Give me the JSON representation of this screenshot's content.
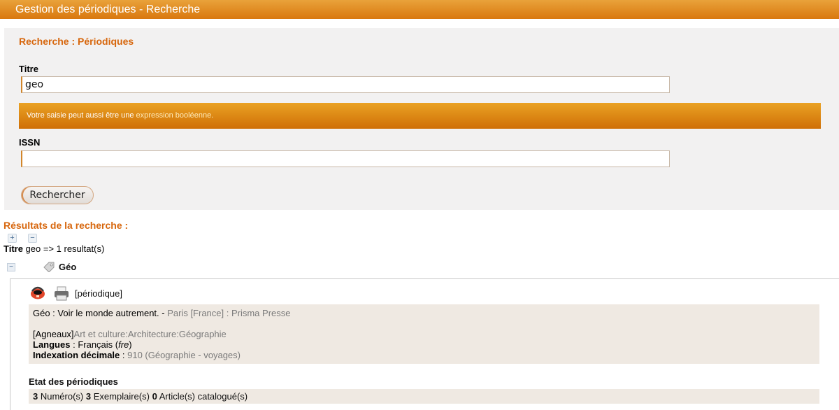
{
  "window": {
    "title": "Gestion des périodiques - Recherche"
  },
  "search": {
    "heading": "Recherche : Périodiques",
    "title_label": "Titre",
    "title_value": "geo",
    "info_text": "Votre saisie peut aussi être une",
    "info_link": "expression booléenne.",
    "issn_label": "ISSN",
    "issn_value": "",
    "button_label": "Rechercher"
  },
  "results": {
    "heading": "Résultats de la recherche :",
    "expand_all": "+",
    "collapse_all": "−",
    "summary_field": "Titre",
    "summary_text": " geo => 1 resultat(s)",
    "items": [
      {
        "collapse_symbol": "−",
        "title": "Géo",
        "type": "[périodique]",
        "isbd_title": "Géo : Voir le monde autrement. - ",
        "isbd_publisher": "Paris [France] : Prisma Presse",
        "category_scheme": "[Agneaux]",
        "category_path": "Art et culture:Architecture:Géographie",
        "languages_label": "Langues",
        "languages_value": "Français",
        "languages_code": "fre",
        "dewey_label": "Indexation décimale",
        "dewey_value": "910 (Géographie - voyages)",
        "state_heading": "Etat des périodiques",
        "issues_count": "3",
        "issues_label": "Numéro(s)",
        "copies_count": "3",
        "copies_label": "Exemplaire(s)",
        "articles_count": "0",
        "articles_label": "Article(s) catalogué(s)"
      }
    ]
  },
  "colors": {
    "accent": "#d7660c",
    "titlebar": "#e08a20",
    "panel": "#f2f1f1",
    "detail_bg": "#efe9e2"
  },
  "icons": [
    "tag-icon",
    "basket-icon",
    "printer-icon",
    "expand-all-icon",
    "collapse-all-icon",
    "collapse-icon"
  ]
}
